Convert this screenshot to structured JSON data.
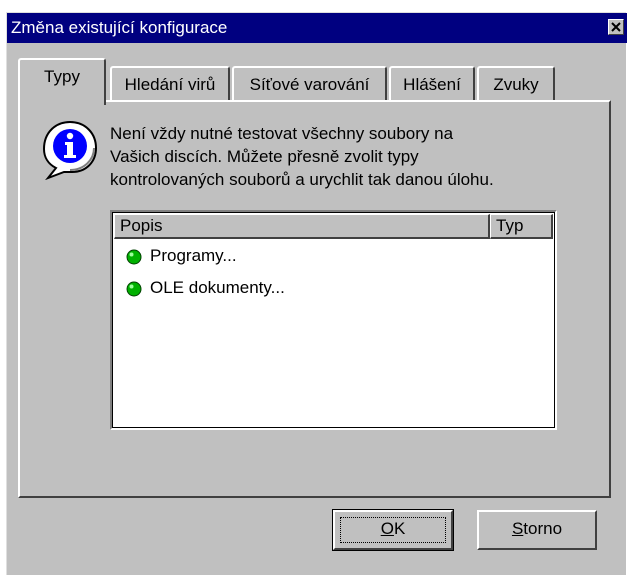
{
  "window": {
    "title": "Změna existující konfigurace"
  },
  "tabs": [
    {
      "label": "Typy",
      "active": true
    },
    {
      "label": "Hledání virů",
      "active": false
    },
    {
      "label": "Síťové varování",
      "active": false
    },
    {
      "label": "Hlášení",
      "active": false
    },
    {
      "label": "Zvuky",
      "active": false
    }
  ],
  "info": {
    "icon": "info-icon",
    "lines": [
      "Není vždy nutné testovat všechny soubory na",
      "Vašich discích. Můžete přesně zvolit typy",
      "kontrolovaných souborů a urychlit tak danou úlohu."
    ]
  },
  "list": {
    "columns": [
      "Popis",
      "Typ"
    ],
    "items": [
      {
        "label": "Programy...",
        "bullet_color": "#00c000"
      },
      {
        "label": "OLE dokumenty...",
        "bullet_color": "#00c000"
      }
    ]
  },
  "buttons": {
    "ok_label": "OK",
    "ok_mnemonic": "O",
    "ok_rest": "K",
    "cancel_label": "Storno",
    "cancel_mnemonic": "S",
    "cancel_rest": "torno"
  },
  "colors": {
    "titlebar": "#000080",
    "face": "#c0c0c0"
  }
}
